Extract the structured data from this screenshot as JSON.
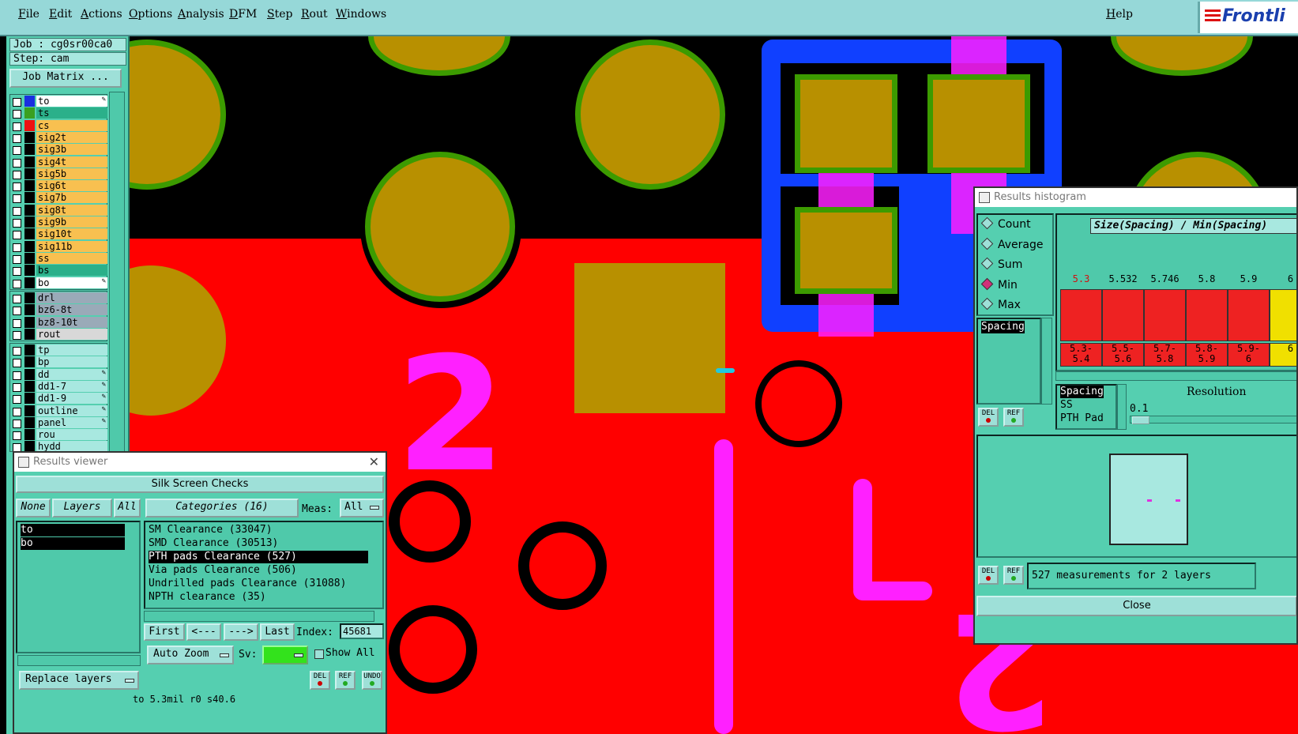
{
  "menubar": {
    "items": [
      "File",
      "Edit",
      "Actions",
      "Options",
      "Analysis",
      "DFM",
      "Step",
      "Rout",
      "Windows"
    ],
    "help": "Help",
    "logo_text": "Frontli"
  },
  "left_panel": {
    "job_label": "Job : cg0sr00ca0",
    "step_label": "Step: cam",
    "job_matrix_button": "Job Matrix ...",
    "layers": [
      {
        "name": "to",
        "color": "#1a2fe0",
        "bg": "#ffffff",
        "icon": "edit"
      },
      {
        "name": "ts",
        "color": "#3aa020",
        "bg": "#2bb08a",
        "icon": ""
      },
      {
        "name": "cs",
        "color": "#ee1111",
        "bg": "#f8c050",
        "icon": ""
      },
      {
        "name": "sig2t",
        "color": "#000000",
        "bg": "#f8c050",
        "icon": ""
      },
      {
        "name": "sig3b",
        "color": "#000000",
        "bg": "#f8c050",
        "icon": ""
      },
      {
        "name": "sig4t",
        "color": "#000000",
        "bg": "#f8c050",
        "icon": ""
      },
      {
        "name": "sig5b",
        "color": "#000000",
        "bg": "#f8c050",
        "icon": ""
      },
      {
        "name": "sig6t",
        "color": "#000000",
        "bg": "#f8c050",
        "icon": ""
      },
      {
        "name": "sig7b",
        "color": "#000000",
        "bg": "#f8c050",
        "icon": ""
      },
      {
        "name": "sig8t",
        "color": "#000000",
        "bg": "#f8c050",
        "icon": ""
      },
      {
        "name": "sig9b",
        "color": "#000000",
        "bg": "#f8c050",
        "icon": ""
      },
      {
        "name": "sig10t",
        "color": "#000000",
        "bg": "#f8c050",
        "icon": ""
      },
      {
        "name": "sig11b",
        "color": "#000000",
        "bg": "#f8c050",
        "icon": ""
      },
      {
        "name": "ss",
        "color": "#000000",
        "bg": "#f8c050",
        "icon": ""
      },
      {
        "name": "bs",
        "color": "#000000",
        "bg": "#2bb08a",
        "icon": ""
      },
      {
        "name": "bo",
        "color": "#000000",
        "bg": "#ffffff",
        "icon": "edit"
      }
    ],
    "drill_layers": [
      {
        "name": "drl",
        "bg": "#9aaab8"
      },
      {
        "name": "bz6-8t",
        "bg": "#9aaab8"
      },
      {
        "name": "bz8-10t",
        "bg": "#9aaab8"
      },
      {
        "name": "rout",
        "bg": "#d8d8d8"
      }
    ],
    "misc_layers": [
      {
        "name": "tp",
        "icon": ""
      },
      {
        "name": "bp",
        "icon": ""
      },
      {
        "name": "dd",
        "icon": "edit"
      },
      {
        "name": "dd1-7",
        "icon": "edit"
      },
      {
        "name": "dd1-9",
        "icon": "edit"
      },
      {
        "name": "outline",
        "icon": "edit"
      },
      {
        "name": "panel",
        "icon": "edit"
      },
      {
        "name": "rou",
        "icon": ""
      },
      {
        "name": "hydd",
        "icon": ""
      }
    ]
  },
  "canvas": {
    "silk_numbers": [
      "2",
      "2"
    ]
  },
  "results_viewer": {
    "title": "Results viewer",
    "header_button": "Silk Screen Checks",
    "none_button": "None",
    "layers_label": "Layers",
    "all_button": "All",
    "layers_list": [
      "to",
      "bo"
    ],
    "categories_button": "Categories (16)",
    "meas_label": "Meas:",
    "meas_value": "All",
    "categories": [
      "SM Clearance (33047)",
      "SMD Clearance (30513)",
      "PTH pads Clearance (527)",
      "Via pads Clearance (506)",
      "Undrilled pads Clearance (31088)",
      "NPTH clearance (35)"
    ],
    "selected_category": 2,
    "nav": {
      "first": "First",
      "prev": "<---",
      "next": "--->",
      "last": "Last",
      "index_label": "Index:",
      "index_value": "45681"
    },
    "auto_zoom": "Auto Zoom",
    "sv_label": "Sv:",
    "show_all": "Show All",
    "replace_layers": "Replace layers",
    "mini_buttons": [
      "DEL",
      "REF",
      "UNDO"
    ],
    "status_text": "to 5.3mil r0 s40.6"
  },
  "results_histogram": {
    "title": "Results histogram",
    "modes": [
      "Count",
      "Average",
      "Sum",
      "Min",
      "Max"
    ],
    "selected_mode": "Min",
    "chart_title": "Size(Spacing) / Min(Spacing)",
    "bars": [
      {
        "label": "5.3",
        "range": "5.3-\n5.4",
        "color": "#ee2222",
        "highlight": true
      },
      {
        "label": "5.532",
        "range": "5.5-\n5.6",
        "color": "#ee2222",
        "highlight": false
      },
      {
        "label": "5.746",
        "range": "5.7-\n5.8",
        "color": "#ee2222",
        "highlight": false
      },
      {
        "label": "5.8",
        "range": "5.8-\n5.9",
        "color": "#ee2222",
        "highlight": false
      },
      {
        "label": "5.9",
        "range": "5.9-\n6",
        "color": "#ee2222",
        "highlight": false
      },
      {
        "label": "6",
        "range": "6",
        "color": "#f0e000",
        "highlight": false
      }
    ],
    "spacing_list": [
      "Spacing"
    ],
    "type_list": [
      "Spacing",
      "SS",
      "PTH Pad"
    ],
    "resolution_label": "Resolution",
    "resolution_value": "0.1",
    "mini_buttons": [
      "DEL",
      "REF"
    ],
    "measurements_text": "527 measurements for 2 layers",
    "close_button": "Close"
  }
}
